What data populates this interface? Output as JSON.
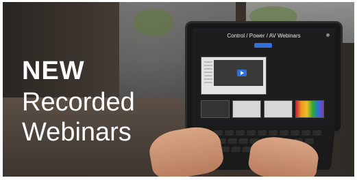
{
  "headline": {
    "line1": "NEW",
    "line2": "Recorded",
    "line3": "Webinars"
  },
  "tablet_screen": {
    "title": "Control / Power / AV Webinars"
  },
  "colors": {
    "accent": "#2f6fd6",
    "headline_text": "#ffffff"
  }
}
